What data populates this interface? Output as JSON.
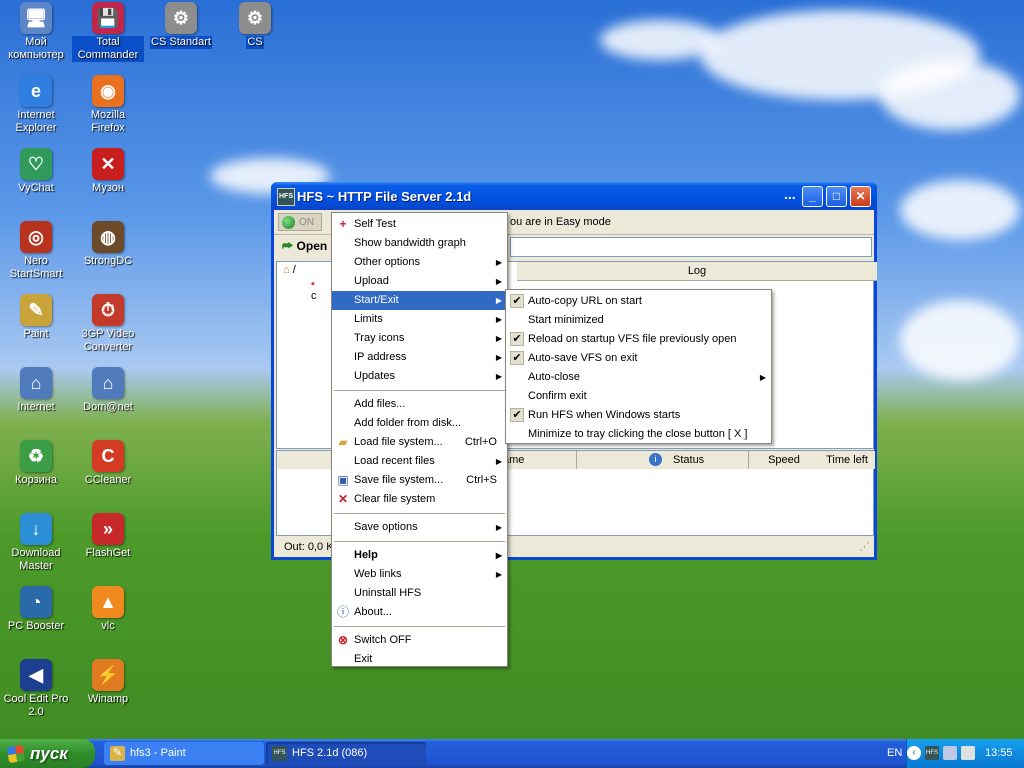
{
  "desktop": {
    "icons": [
      {
        "label": "Мой компьютер",
        "icon": "computer-icon",
        "color": "#5d86c9"
      },
      {
        "label": "Total Commander",
        "icon": "floppy-icon",
        "color": "#c0264a"
      },
      {
        "label": "CS Standart",
        "icon": "cs-app-icon",
        "color": "#8d8d8d"
      },
      {
        "label": "CS",
        "icon": "cs-app-icon",
        "color": "#8d8d8d"
      },
      {
        "label": "Internet Explorer",
        "icon": "internet-explorer-icon",
        "color": "#2f7fe0"
      },
      {
        "label": "Mozilla Firefox",
        "icon": "firefox-icon",
        "color": "#e8701f"
      },
      {
        "label": "VyChat",
        "icon": "vychat-icon",
        "color": "#2f9a5b"
      },
      {
        "label": "Музон",
        "icon": "muzon-icon",
        "color": "#c91e1e"
      },
      {
        "label": "Nero StartSmart",
        "icon": "nero-icon",
        "color": "#b7331e"
      },
      {
        "label": "StrongDC",
        "icon": "strongdc-icon",
        "color": "#6b4a2a"
      },
      {
        "label": "Paint",
        "icon": "paint-icon",
        "color": "#c8a43a"
      },
      {
        "label": "3GP Video Converter",
        "icon": "video-converter-icon",
        "color": "#c33a2a"
      },
      {
        "label": "Internet",
        "icon": "network-icon",
        "color": "#4f7bbd"
      },
      {
        "label": "Dom@net",
        "icon": "network-icon",
        "color": "#4f7bbd"
      },
      {
        "label": "Корзина",
        "icon": "recycle-bin-icon",
        "color": "#3c9d47"
      },
      {
        "label": "CCleaner",
        "icon": "ccleaner-icon",
        "color": "#d33b24"
      },
      {
        "label": "Download Master",
        "icon": "download-master-icon",
        "color": "#2a8fd4"
      },
      {
        "label": "FlashGet",
        "icon": "flashget-icon",
        "color": "#c7292b"
      },
      {
        "label": "PC Booster",
        "icon": "pc-booster-icon",
        "color": "#2a6aa8"
      },
      {
        "label": "vlc",
        "icon": "vlc-cone-icon",
        "color": "#f08a1e"
      },
      {
        "label": "Cool Edit Pro 2.0",
        "icon": "cool-edit-icon",
        "color": "#1d3f8f"
      },
      {
        "label": "Winamp",
        "icon": "winamp-icon",
        "color": "#e07b22"
      }
    ]
  },
  "window": {
    "title": "HFS ~ HTTP File Server 2.1d",
    "title_dots": "...",
    "on_button": "ON",
    "easy_mode_text": "ou are in Easy mode",
    "open_label": "Open",
    "log_header": "Log",
    "tree_root": "/",
    "tree_child_fragment": "c",
    "columns": {
      "name": "ame",
      "status": "Status",
      "speed": "Speed",
      "time_left": "Time left"
    },
    "status_out": "Out: 0,0 K"
  },
  "context_menu": {
    "items": [
      {
        "label": "Self Test",
        "icon": "plus-icon",
        "submenu": false
      },
      {
        "label": "Show bandwidth graph",
        "submenu": false
      },
      {
        "label": "Other options",
        "submenu": true
      },
      {
        "label": "Upload",
        "submenu": true
      },
      {
        "label": "Start/Exit",
        "submenu": true,
        "highlighted": true
      },
      {
        "label": "Limits",
        "submenu": true
      },
      {
        "label": "Tray icons",
        "submenu": true
      },
      {
        "label": "IP address",
        "submenu": true
      },
      {
        "label": "Updates",
        "submenu": true
      },
      {
        "sep": true
      },
      {
        "label": "Add files...",
        "submenu": false
      },
      {
        "label": "Add folder from disk...",
        "submenu": false
      },
      {
        "label": "Load file system...",
        "shortcut": "Ctrl+O",
        "icon": "folder-open-icon"
      },
      {
        "label": "Load recent files",
        "submenu": true
      },
      {
        "label": "Save file system...",
        "shortcut": "Ctrl+S",
        "icon": "save-icon"
      },
      {
        "label": "Clear file system",
        "icon": "clear-x-icon"
      },
      {
        "sep": true
      },
      {
        "label": "Save options",
        "submenu": true
      },
      {
        "sep": true
      },
      {
        "label": "Help",
        "submenu": true,
        "bold": true
      },
      {
        "label": "Web links",
        "submenu": true
      },
      {
        "label": "Uninstall HFS"
      },
      {
        "label": "About...",
        "icon": "info-icon"
      },
      {
        "sep": true
      },
      {
        "label": "Switch OFF",
        "icon": "switch-off-icon"
      },
      {
        "label": "Exit"
      }
    ]
  },
  "submenu": {
    "items": [
      {
        "label": "Auto-copy URL on start",
        "checked": true
      },
      {
        "label": "Start minimized",
        "checked": false
      },
      {
        "label": "Reload on startup VFS file previously open",
        "checked": true
      },
      {
        "label": "Auto-save VFS on exit",
        "checked": true
      },
      {
        "label": "Auto-close",
        "checked": false,
        "submenu": true
      },
      {
        "label": "Confirm exit",
        "checked": false
      },
      {
        "label": "Run HFS when Windows starts",
        "checked": true
      },
      {
        "label": "Minimize to tray clicking the close button [ X ]",
        "checked": false
      }
    ]
  },
  "taskbar": {
    "start_label": "пуск",
    "tasks": [
      {
        "label": "hfs3 - Paint",
        "active": false
      },
      {
        "label": "HFS 2.1d (086)",
        "active": true
      }
    ],
    "language": "EN",
    "clock": "13:55"
  },
  "colors": {
    "highlight": "#316ac5",
    "title_blue": "#0a46d8"
  }
}
